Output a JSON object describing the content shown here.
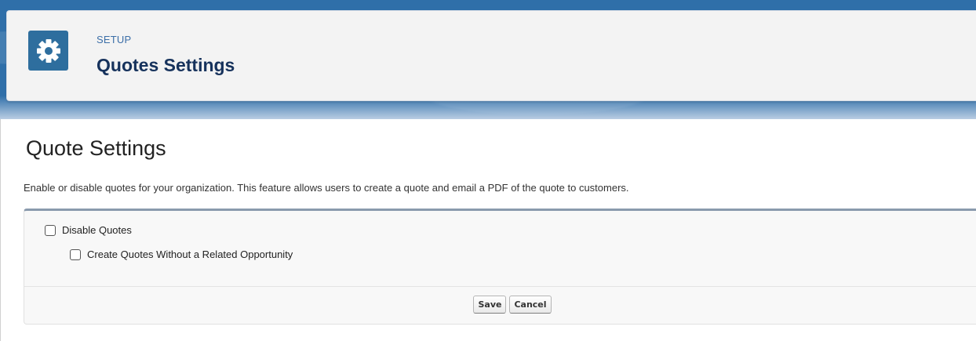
{
  "header": {
    "breadcrumb": "SETUP",
    "title": "Quotes Settings",
    "icon": "gear-icon"
  },
  "content": {
    "title": "Quote Settings",
    "description": "Enable or disable quotes for your organization. This feature allows users to create a quote and email a PDF of the quote to customers."
  },
  "options": [
    {
      "label": "Disable Quotes",
      "checked": false
    },
    {
      "label": "Create Quotes Without a Related Opportunity",
      "checked": false
    }
  ],
  "buttons": {
    "save_label": "Save",
    "cancel_label": "Cancel"
  },
  "colors": {
    "brand_band": "#2f6fa9",
    "icon_bg": "#2e6e9e",
    "title_text": "#16325c",
    "breadcrumb_text": "#3c6fa8"
  }
}
